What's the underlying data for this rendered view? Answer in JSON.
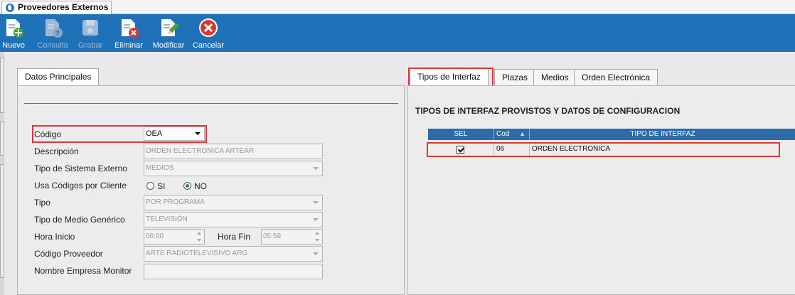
{
  "window_tab": {
    "title": "Proveedores Externos"
  },
  "toolbar": {
    "nuevo": "Nuevo",
    "consulta": "Consulta",
    "grabar": "Grabar",
    "eliminar": "Eliminar",
    "modificar": "Modificar",
    "cancelar": "Cancelar"
  },
  "left_panel": {
    "tab": "Datos Principales",
    "fields": {
      "codigo_label": "Código",
      "codigo_value": "OEA",
      "descripcion_label": "Descripción",
      "descripcion_value": "ORDEN ELECTRONICA ARTEAR",
      "tipo_sistema_label": "Tipo de Sistema Externo",
      "tipo_sistema_value": "MEDIOS",
      "usa_codigos_label": "Usa Códigos por Cliente",
      "radio_si": "SI",
      "radio_no": "NO",
      "tipo_label": "Tipo",
      "tipo_value": "POR PROGRAMA",
      "tipo_medio_label": "Tipo de Medio Genérico",
      "tipo_medio_value": "TELEVISIÓN",
      "hora_inicio_label": "Hora Inicio",
      "hora_inicio_value": "06:00",
      "hora_fin_label": "Hora Fin",
      "hora_fin_value": "05:59",
      "codigo_proveedor_label": "Código Proveedor",
      "codigo_proveedor_value": "ARTE RADIOTELEVISIVO ARG",
      "nombre_empresa_label": "Nombre Empresa Monitor",
      "nombre_empresa_value": ""
    }
  },
  "right_panel": {
    "tabs": [
      "Tipos de Interfaz",
      "Plazas",
      "Medios",
      "Orden Electrónica"
    ],
    "section_title": "TIPOS DE INTERFAZ PROVISTOS Y DATOS DE CONFIGURACION",
    "grid": {
      "headers": [
        "SEL",
        "Cod",
        "TIPO DE INTERFAZ"
      ],
      "rows": [
        {
          "sel": true,
          "cod": "06",
          "tipo": "ORDEN ELECTRONICA"
        }
      ]
    }
  }
}
